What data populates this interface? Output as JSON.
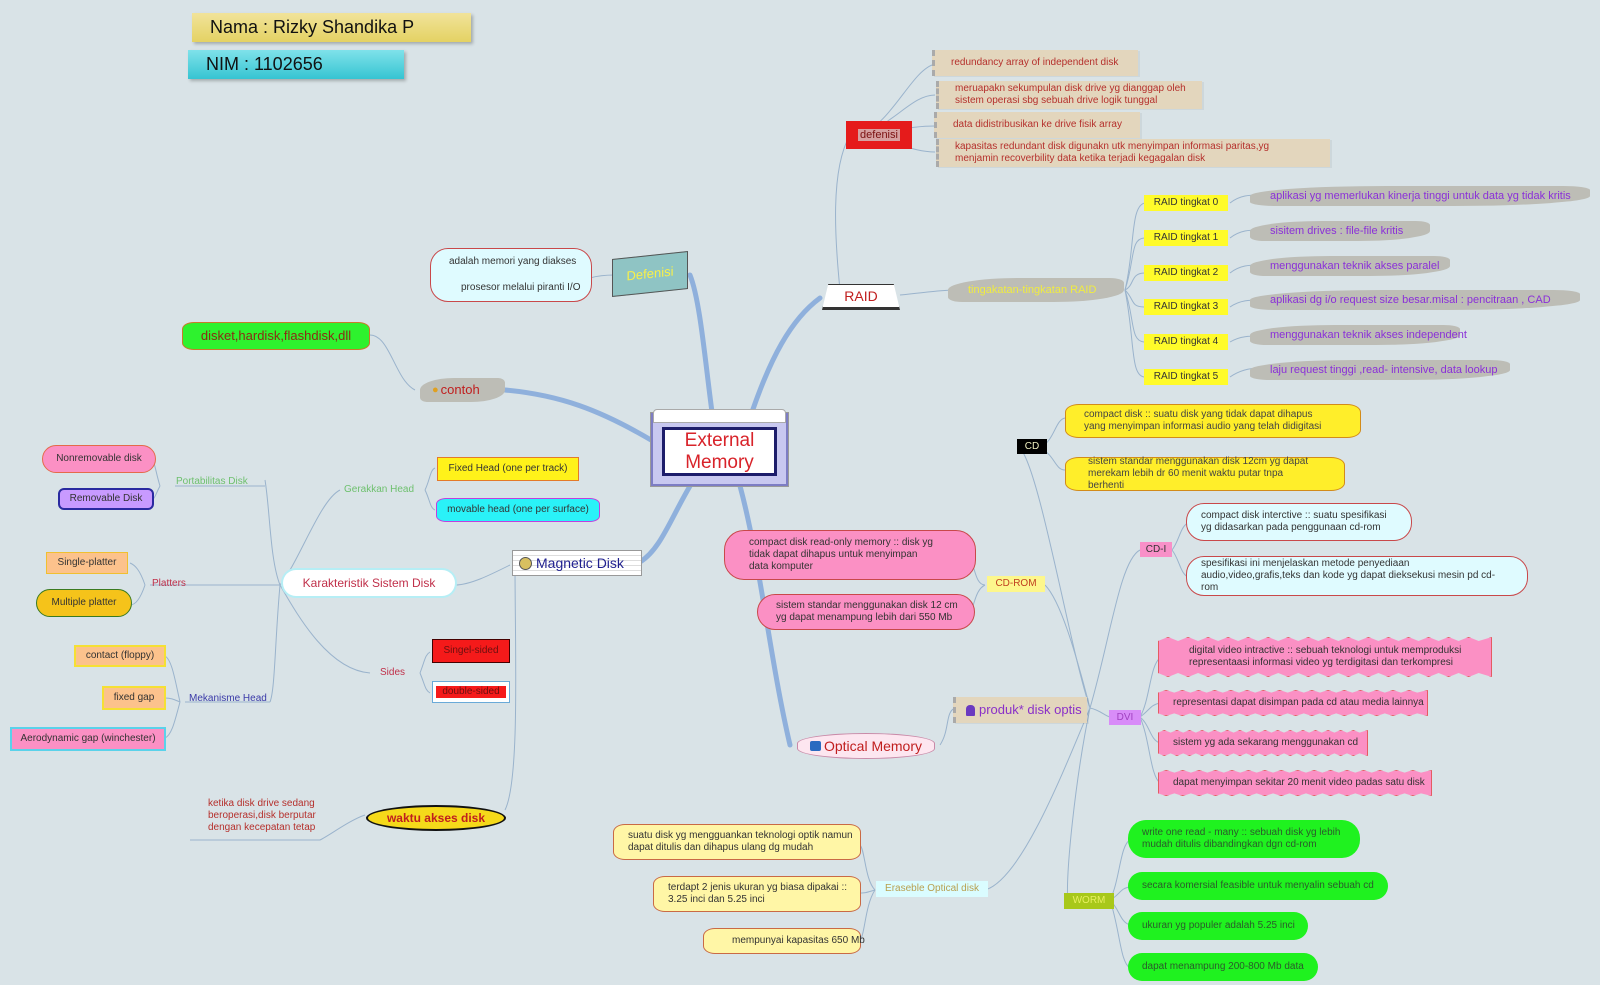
{
  "header": {
    "name_label": "Nama : Rizky Shandika P",
    "nim_label": "NIM : 1102656"
  },
  "central": {
    "title": "External Memory"
  },
  "defenisi": {
    "label": "Defenisi",
    "text_line1": "adalah memori yang diakses",
    "text_line2": "prosesor melalui piranti I/O"
  },
  "contoh": {
    "label": "contoh",
    "text": "disket,hardisk,flashdisk,dll"
  },
  "raid": {
    "label": "RAID",
    "defenisi": {
      "label": "defenisi",
      "items": [
        "redundancy array of independent disk",
        "meruapakn sekumpulan disk drive yg dianggap oleh sistem operasi sbg sebuah drive logik tunggal",
        "data didistribusikan ke drive fisik array",
        "kapasitas redundant disk digunakn utk menyimpan informasi paritas,yg menjamin recoverbility data ketika terjadi kegagalan disk"
      ]
    },
    "levels_label": "tingakatan-tingkatan RAID",
    "levels": [
      {
        "name": "RAID tingkat 0",
        "desc": "aplikasi yg memerlukan kinerja tinggi untuk data yg tidak kritis"
      },
      {
        "name": "RAID tingkat 1",
        "desc": "sisitem drives : file-file kritis"
      },
      {
        "name": "RAID tingkat 2",
        "desc": "menggunakan teknik akses paralel"
      },
      {
        "name": "RAID tingkat 3",
        "desc": "aplikasi dg i/o request size besar.misal : pencitraan , CAD"
      },
      {
        "name": "RAID tingkat 4",
        "desc": "menggunakan teknik akses independent"
      },
      {
        "name": "RAID tingkat 5",
        "desc": "laju request tinggi ,read- intensive, data lookup"
      }
    ]
  },
  "magnetic": {
    "label": "Magnetic Disk",
    "karakteristik": {
      "label": "Karakteristik Sistem Disk",
      "portabilitas": {
        "label": "Portabilitas Disk",
        "items": [
          "Nonremovable disk",
          "Removable Disk"
        ]
      },
      "platters": {
        "label": "Platters",
        "items": [
          "Single-platter",
          "Multiple platter"
        ]
      },
      "mekanisme": {
        "label": "Mekanisme Head",
        "items": [
          "contact (floppy)",
          "fixed gap",
          "Aerodynamic gap (winchester)"
        ]
      },
      "gerakkan": {
        "label": "Gerakkan Head",
        "items": [
          "Fixed Head (one per track)",
          "movable head (one per surface)"
        ]
      },
      "sides": {
        "label": "Sides",
        "items": [
          "Singel-sided",
          "double-sided"
        ]
      }
    },
    "waktu": {
      "label": "waktu akses disk",
      "desc": "ketika disk drive sedang beroperasi,disk berputar dengan kecepatan tetap"
    }
  },
  "optical": {
    "label": "Optical Memory",
    "produk_label": "produk* disk optis",
    "cd": {
      "label": "CD",
      "items": [
        "compact disk :: suatu disk yang tidak dapat dihapus yang menyimpan informasi audio yang telah didigitasi",
        "sistem standar menggunakan disk 12cm yg dapat merekam lebih dr 60 menit waktu putar tnpa berhenti"
      ]
    },
    "cdrom": {
      "label": "CD-ROM",
      "items": [
        "compact disk read-only memory :: disk yg tidak dapat dihapus untuk menyimpan data komputer",
        "sistem standar menggunakan disk 12 cm yg dapat menampung lebih dari 550 Mb"
      ]
    },
    "cdi": {
      "label": "CD-I",
      "items": [
        "compact disk interctive :: suatu spesifikasi yg didasarkan pada penggunaan cd-rom",
        "spesifikasi ini menjelaskan metode penyediaan audio,video,grafis,teks dan kode yg dapat dieksekusi mesin pd cd-rom"
      ]
    },
    "dvi": {
      "label": "DVI",
      "items": [
        "digital video intractive :: sebuah teknologi untuk memproduksi representaasi informasi video yg terdigitasi dan terkompresi",
        "representasi dapat disimpan pada cd atau media lainnya",
        "sistem yg ada sekarang menggunakan cd",
        "dapat menyimpan sekitar 20 menit video padas satu disk"
      ]
    },
    "worm": {
      "label": "WORM",
      "items": [
        "write one read - many :: sebuah disk yg lebih mudah ditulis dibandingkan dgn cd-rom",
        "secara komersial feasible untuk menyalin sebuah cd",
        "ukuran yg populer adalah 5.25 inci",
        "dapat menampung 200-800 Mb data"
      ]
    },
    "erasable": {
      "label": "Eraseble Optical disk",
      "items": [
        "suatu disk yg mengguankan teknologi optik namun dapat ditulis dan dihapus ulang dg mudah",
        "terdapt 2 jenis ukuran yg biasa dipakai :: 3.25 inci dan 5.25 inci",
        "mempunyai kapasitas 650 Mb"
      ]
    }
  },
  "colors": {
    "background": "#d9e3e7",
    "link": "#9ab3cc",
    "main_link": "#8fb0dc",
    "central_text": "#d8232a"
  }
}
